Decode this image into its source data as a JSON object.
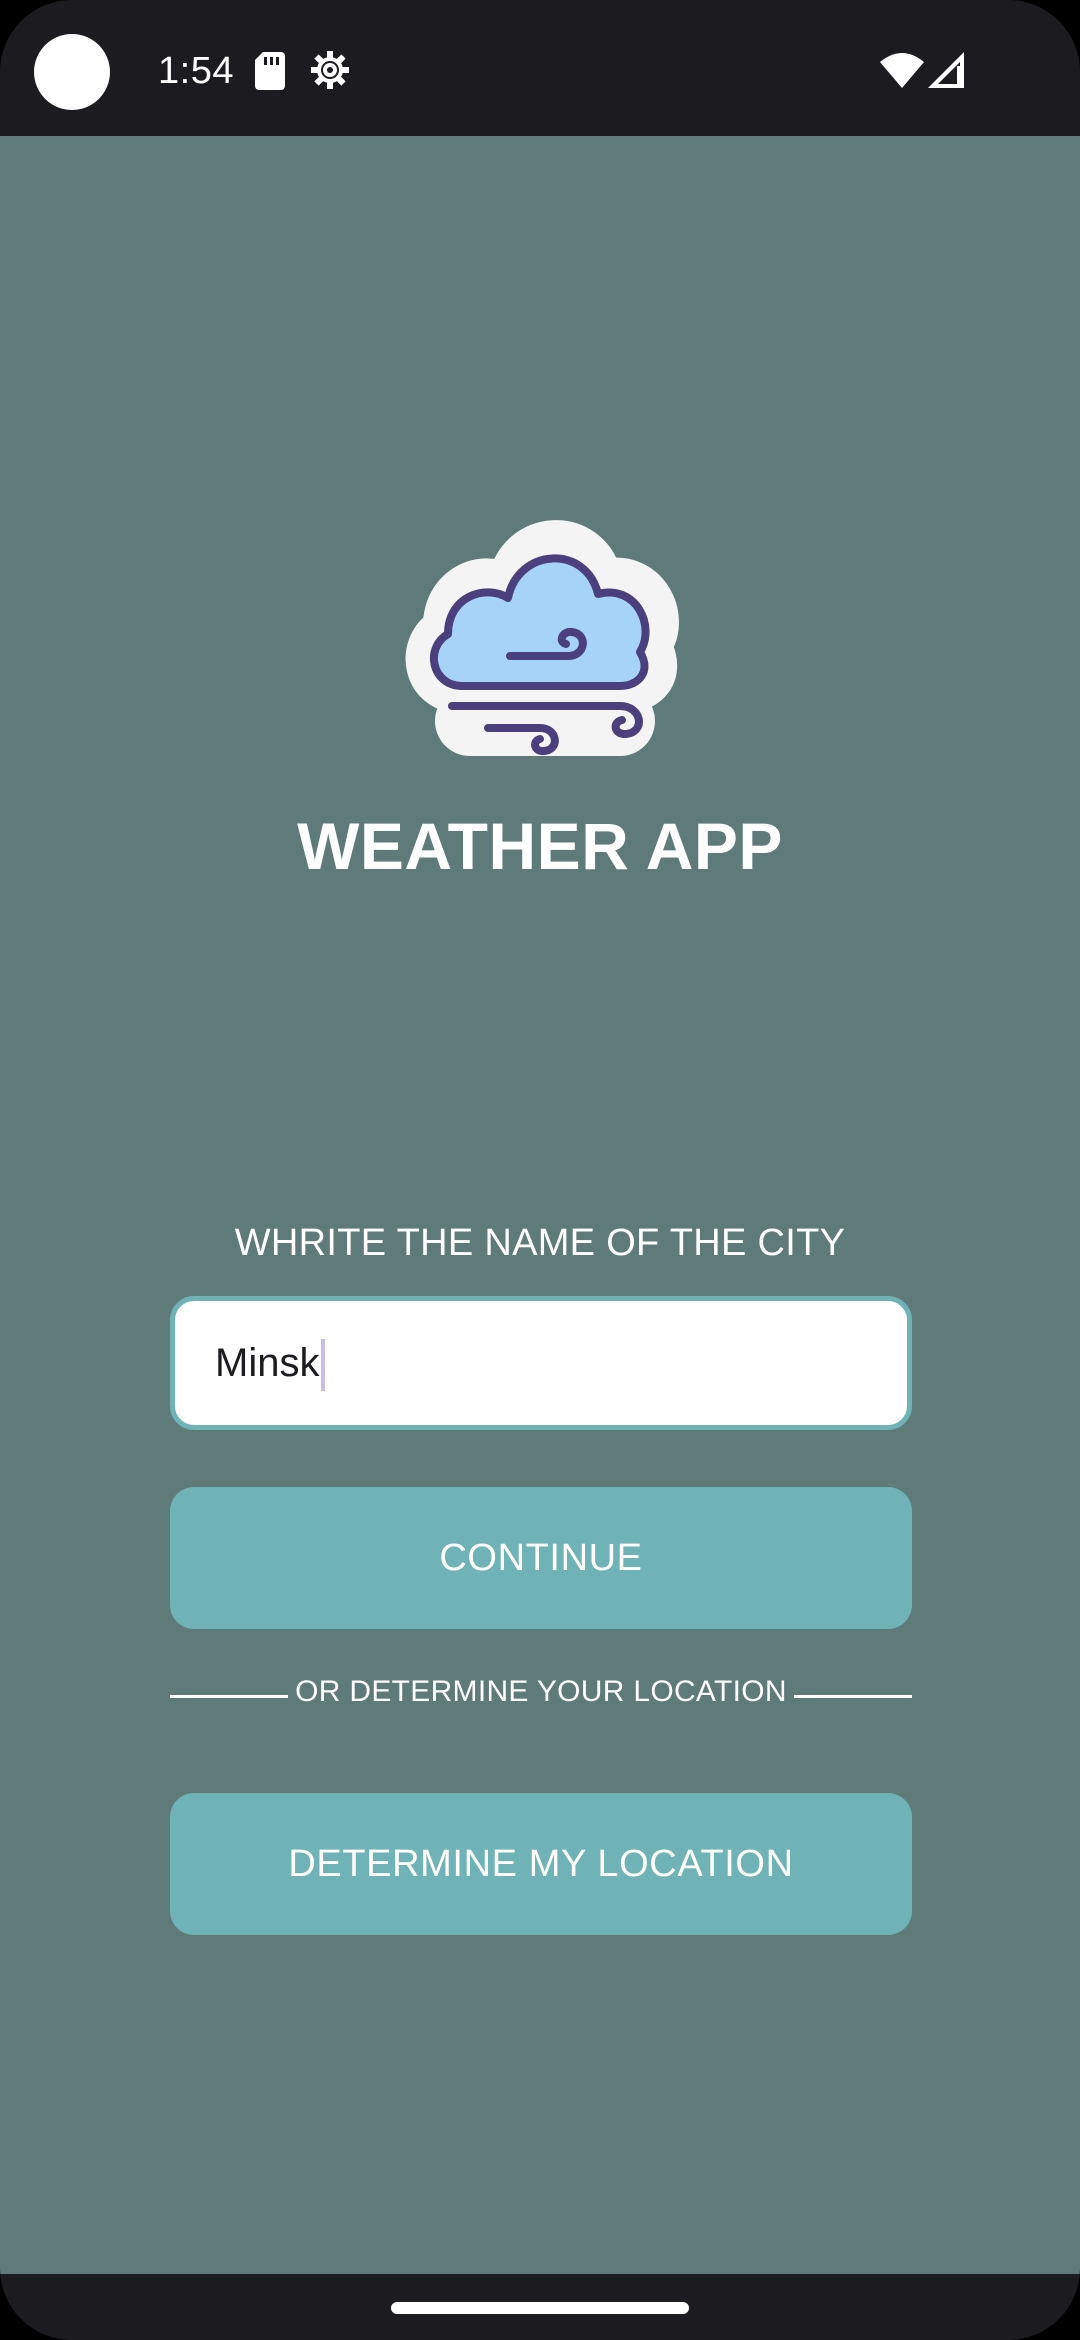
{
  "status_bar": {
    "time": "1:54",
    "icons": [
      "camera-cutout",
      "sd-card-icon",
      "settings-icon",
      "wifi-icon",
      "cell-signal-icon"
    ]
  },
  "app": {
    "title": "WEATHER APP",
    "logo_icon": "cloud-wind-icon",
    "city_prompt": "WHRITE THE NAME OF THE CITY",
    "city_input": {
      "value": "Minsk",
      "placeholder": ""
    },
    "continue_label": "CONTINUE",
    "divider_text": "OR DETERMINE YOUR LOCATION",
    "locate_label": "DETERMINE MY LOCATION"
  },
  "colors": {
    "background": "#5f7b79",
    "accent": "#6fb3b6",
    "system_bar": "#1c1b1f",
    "cloud_fill": "#a6d3f8",
    "cloud_outline": "#4b3f7e"
  }
}
